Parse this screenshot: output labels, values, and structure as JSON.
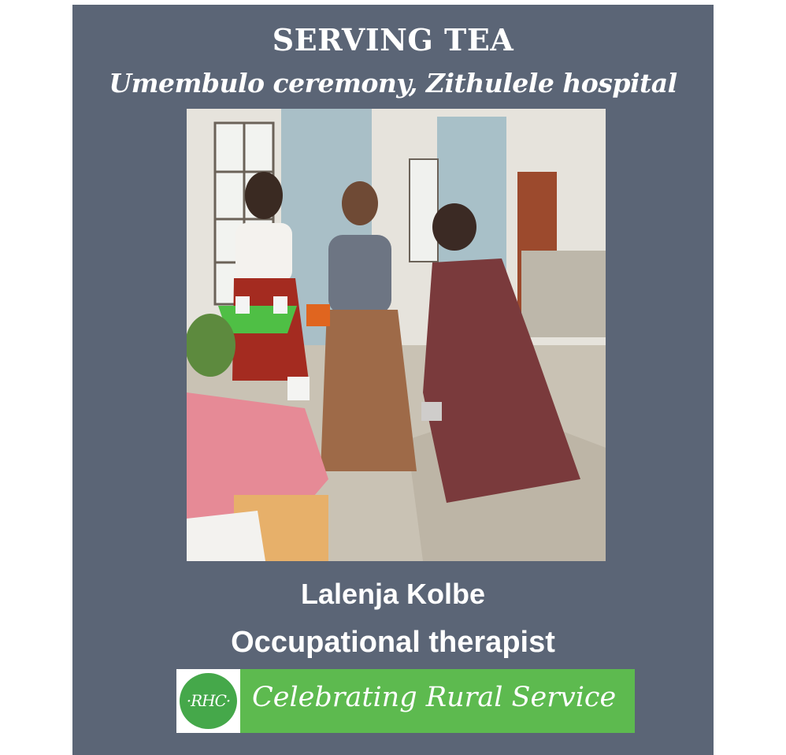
{
  "poster": {
    "title": "SERVING TEA",
    "subtitle": "Umembulo ceremony, Zithulele hospital",
    "name": "Lalenja Kolbe",
    "role": "Occupational therapist",
    "banner": {
      "logo_text": "·RHC·",
      "text": "Celebrating Rural Service"
    }
  },
  "colors": {
    "poster_background": "#5b6576",
    "banner_green": "#5dba4f",
    "logo_green": "#45a84a",
    "text": "#ffffff"
  },
  "photo": {
    "icon": "photo-of-women-serving-tea"
  }
}
